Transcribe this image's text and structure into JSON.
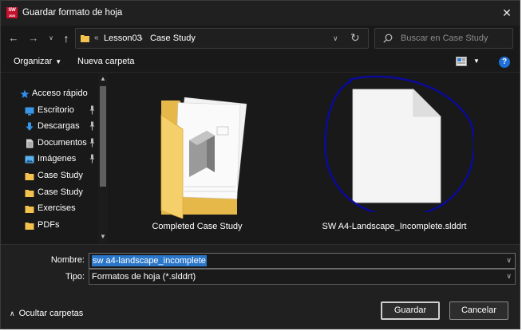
{
  "window": {
    "title": "Guardar formato de hoja",
    "app_icon_text_top": "SW",
    "app_icon_text_bottom": "2023"
  },
  "navigation": {
    "address_segments": [
      "Lesson03",
      "Case Study"
    ],
    "address_prefix": "«",
    "search_placeholder": "Buscar en Case Study"
  },
  "toolbar": {
    "organize_label": "Organizar",
    "new_folder_label": "Nueva carpeta",
    "help_label": "?"
  },
  "sidebar": {
    "items": [
      {
        "label": "Acceso rápido",
        "icon": "star-icon",
        "color": "#2f8fef",
        "pinned": false
      },
      {
        "label": "Escritorio",
        "icon": "desktop-icon",
        "color": "#3a96e8",
        "pinned": true
      },
      {
        "label": "Descargas",
        "icon": "download-icon",
        "color": "#3a96e8",
        "pinned": true
      },
      {
        "label": "Documentos",
        "icon": "document-icon",
        "color": "#cfcfcf",
        "pinned": true
      },
      {
        "label": "Imágenes",
        "icon": "image-icon",
        "color": "#5ab3f0",
        "pinned": true
      },
      {
        "label": "Case Study",
        "icon": "folder-icon",
        "color": "#f2c14e",
        "pinned": false
      },
      {
        "label": "Case Study",
        "icon": "folder-icon",
        "color": "#f2c14e",
        "pinned": false
      },
      {
        "label": "Exercises",
        "icon": "folder-icon",
        "color": "#f2c14e",
        "pinned": false
      },
      {
        "label": "PDFs",
        "icon": "folder-icon",
        "color": "#f2c14e",
        "pinned": false
      }
    ]
  },
  "files": [
    {
      "name": "Completed Case Study",
      "icon": "folder-with-documents-icon"
    },
    {
      "name": "SW A4-Landscape_Incomplete.slddrt",
      "icon": "blank-file-icon",
      "annotated": true
    }
  ],
  "form": {
    "name_label": "Nombre:",
    "name_value": "sw a4-landscape_incomplete",
    "type_label": "Tipo:",
    "type_value": "Formatos de hoja (*.slddrt)"
  },
  "footer": {
    "hide_folders_label": "Ocultar carpetas",
    "save_label": "Guardar",
    "cancel_label": "Cancelar"
  },
  "colors": {
    "background": "#191919",
    "accent": "#2a76c9",
    "annotation": "#0a0aa0",
    "folder": "#f2c14e"
  }
}
